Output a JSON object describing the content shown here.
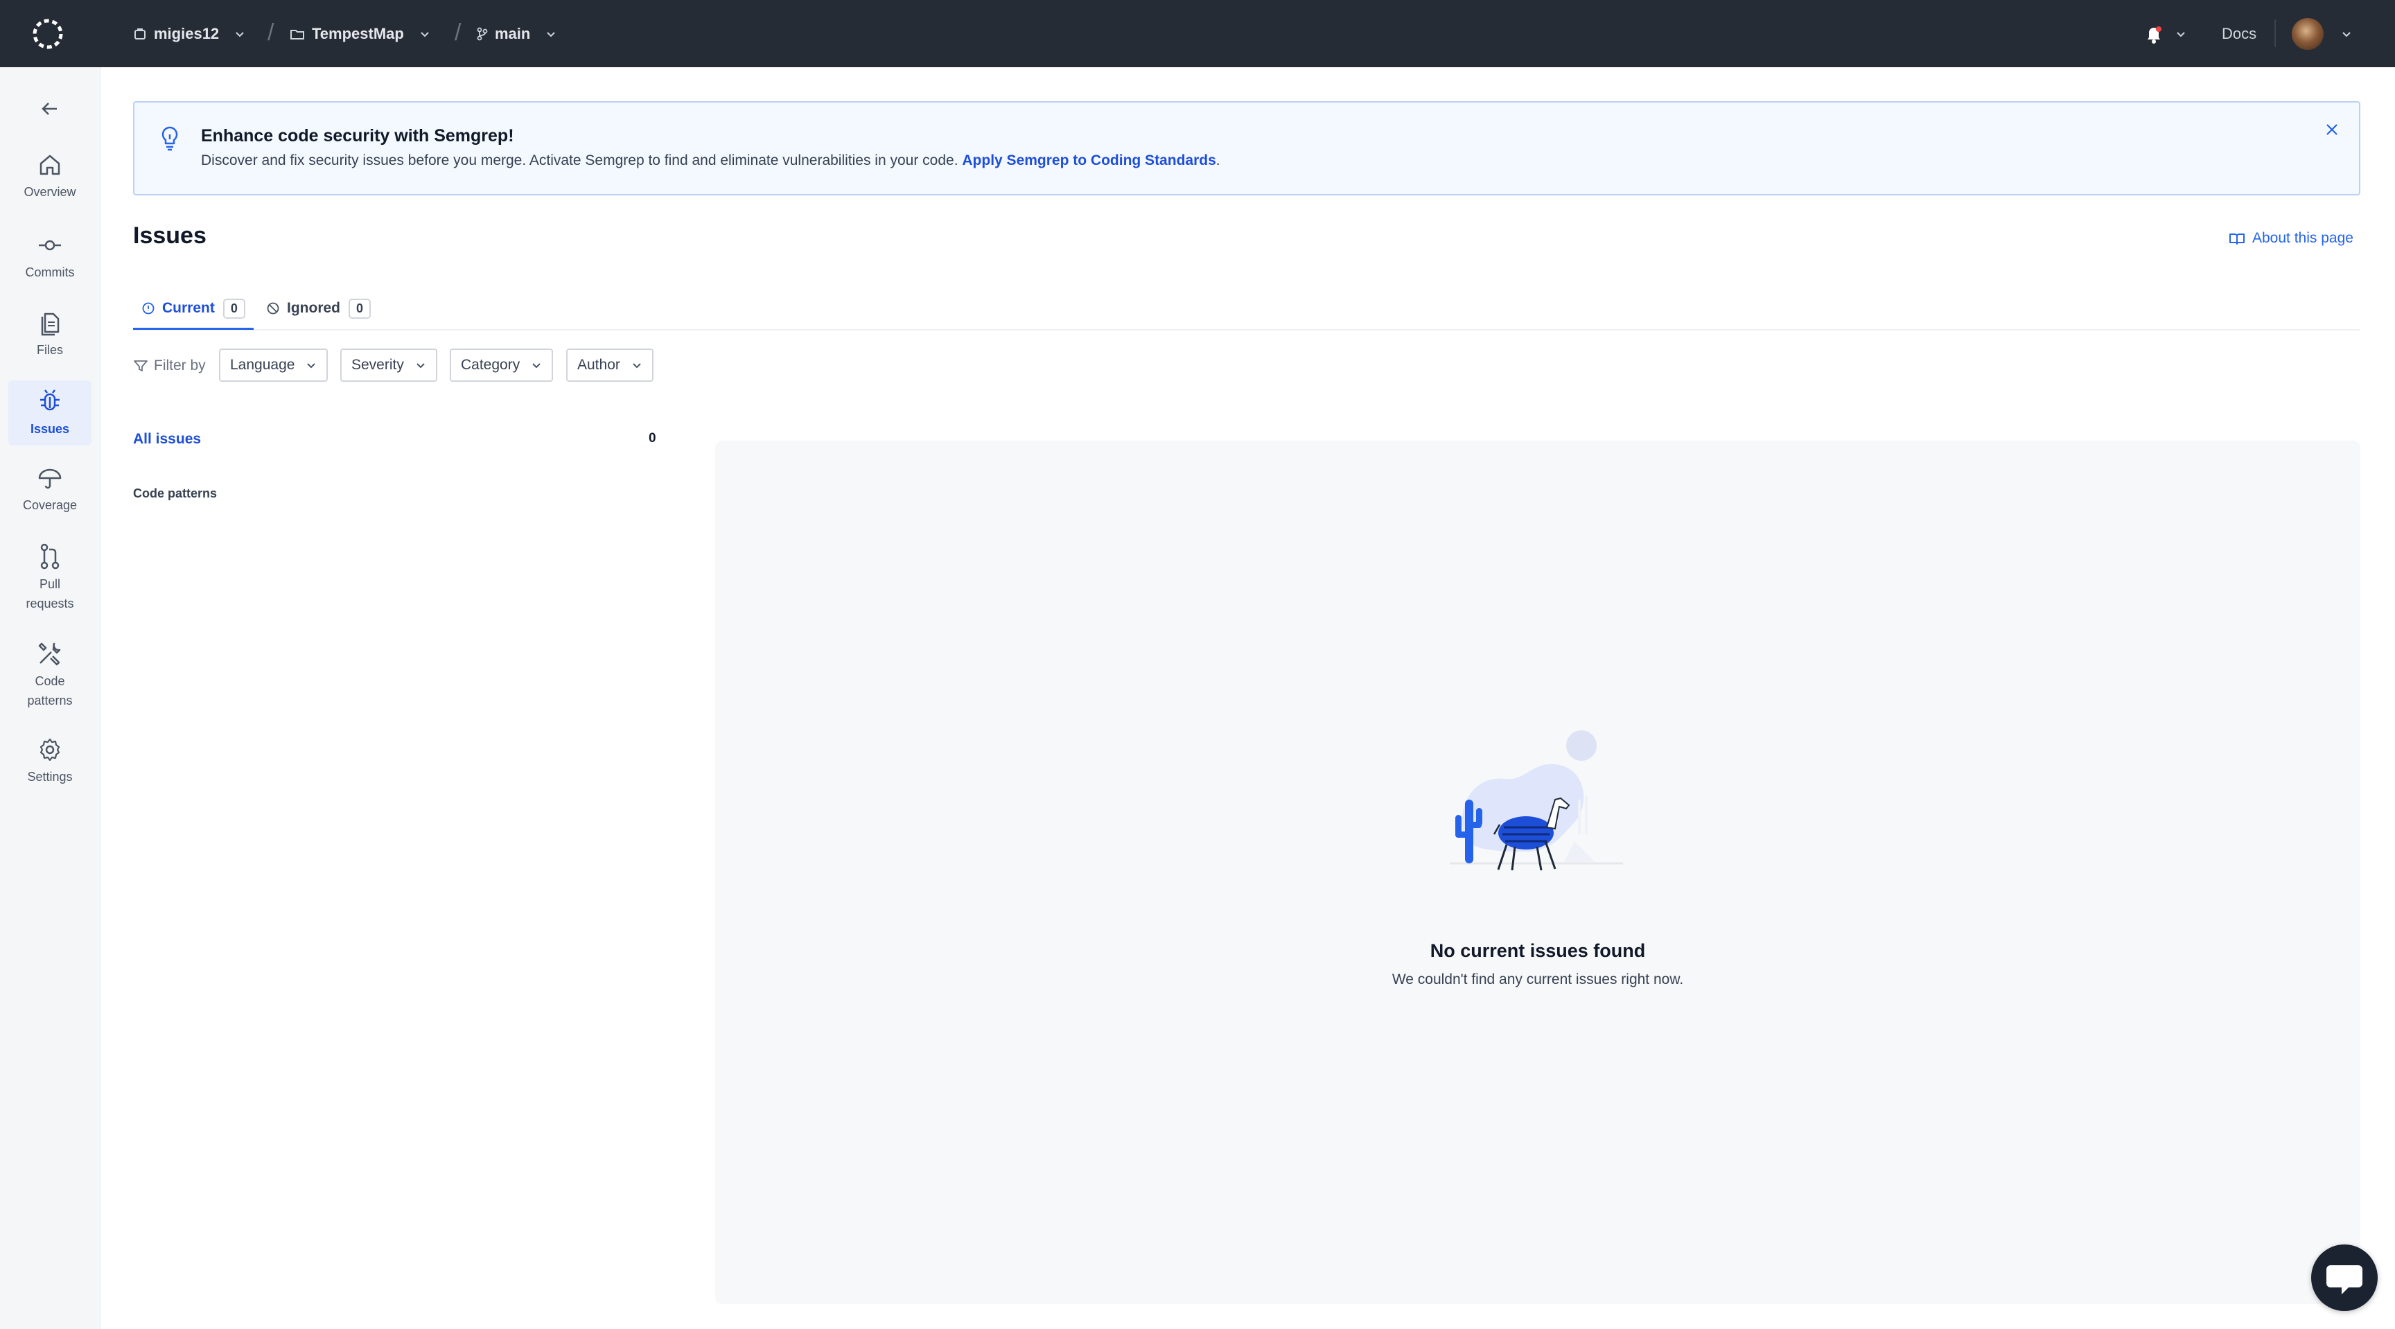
{
  "topbar": {
    "org": "migies12",
    "repo": "TempestMap",
    "branch": "main",
    "docs_label": "Docs"
  },
  "sidebar": {
    "items": [
      {
        "label": "Overview",
        "icon": "home-icon"
      },
      {
        "label": "Commits",
        "icon": "commit-icon"
      },
      {
        "label": "Files",
        "icon": "files-icon"
      },
      {
        "label": "Issues",
        "icon": "bug-icon"
      },
      {
        "label": "Coverage",
        "icon": "umbrella-icon"
      },
      {
        "label": "Pull requests",
        "icon": "pull-request-icon"
      },
      {
        "label": "Code patterns",
        "icon": "tools-icon"
      },
      {
        "label": "Settings",
        "icon": "gear-icon"
      }
    ],
    "active": "Issues"
  },
  "banner": {
    "title": "Enhance code security with Semgrep!",
    "text": "Discover and fix security issues before you merge. Activate Semgrep to find and eliminate vulnerabilities in your code.",
    "link": "Apply Semgrep to Coding Standards",
    "link_suffix": "."
  },
  "page": {
    "title": "Issues",
    "about_link": "About this page"
  },
  "tabs": [
    {
      "label": "Current",
      "count": "0"
    },
    {
      "label": "Ignored",
      "count": "0"
    }
  ],
  "filters": {
    "label": "Filter by",
    "dropdowns": [
      "Language",
      "Severity",
      "Category",
      "Author"
    ]
  },
  "categories": {
    "all_label": "All issues",
    "all_count": "0",
    "code_patterns": "Code patterns"
  },
  "empty": {
    "title": "No current issues found",
    "text": "We couldn't find any current issues right now."
  },
  "colors": {
    "topbar": "#262c36",
    "accent": "#2563eb",
    "sidebar_bg": "#f5f6f8"
  }
}
